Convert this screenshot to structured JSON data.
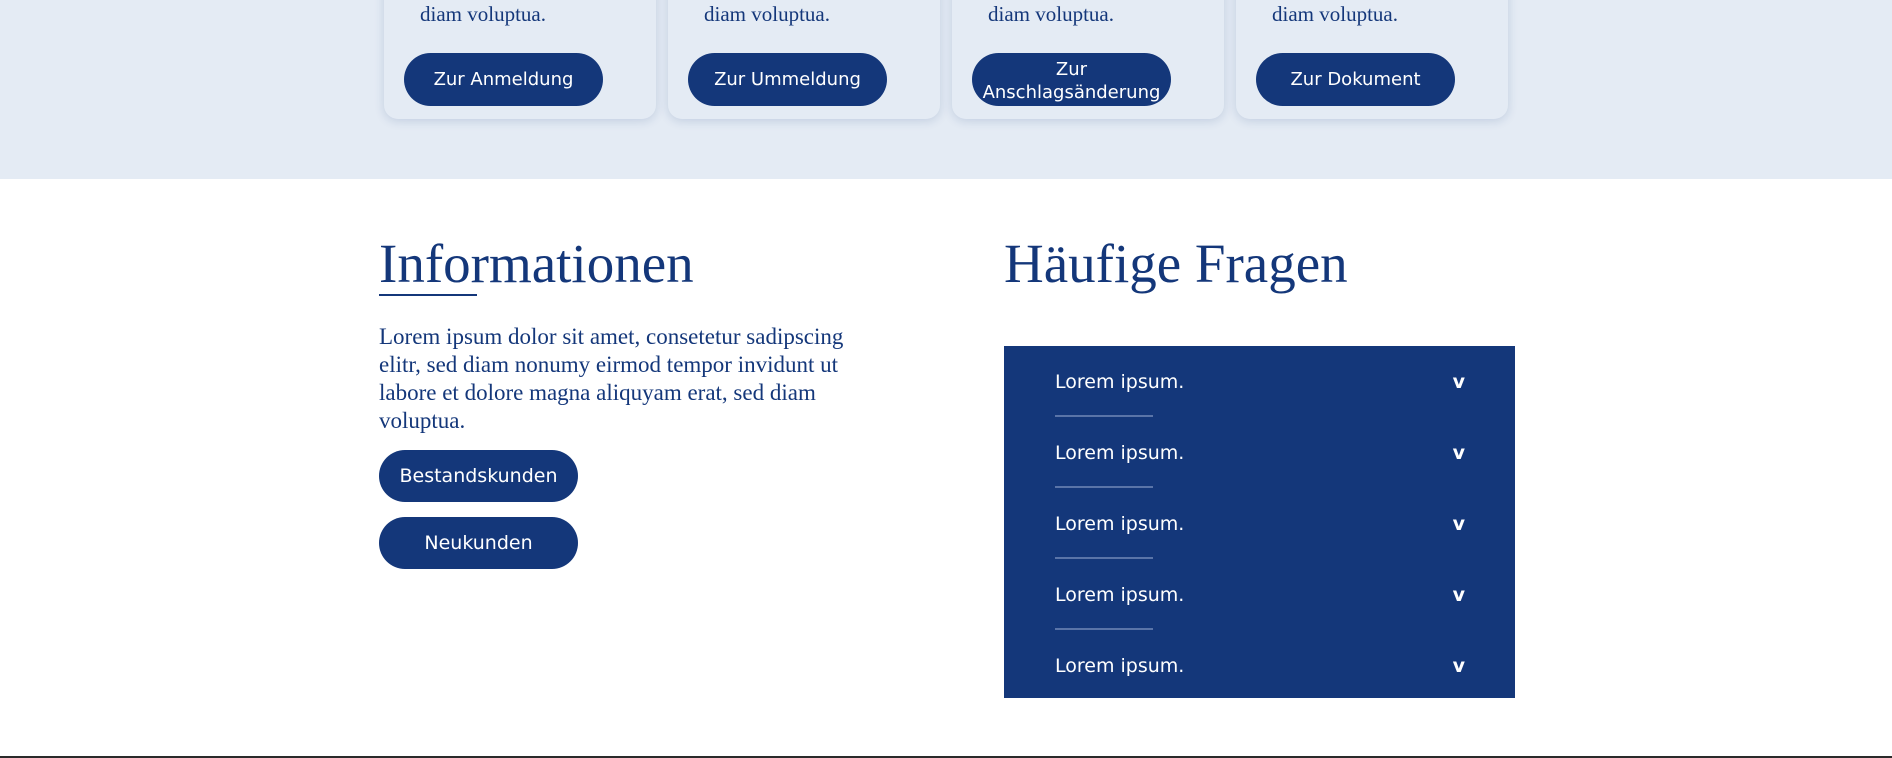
{
  "cards": [
    {
      "text": "diam voluptua.",
      "button": "Zur Anmeldung"
    },
    {
      "text": "diam voluptua.",
      "button": "Zur Ummeldung"
    },
    {
      "text": "diam voluptua.",
      "button_line1": "Zur",
      "button_line2": "Anschlagsänderung"
    },
    {
      "text": "diam voluptua.",
      "button": "Zur Dokument"
    }
  ],
  "info": {
    "title": "Informationen",
    "text": "Lorem ipsum dolor sit amet, consetetur sadipscing elitr, sed diam nonumy eirmod tempor invidunt ut labore et dolore magna aliquyam erat, sed diam voluptua.",
    "buttons": [
      "Bestandskunden",
      "Neukunden"
    ]
  },
  "faq": {
    "title": "Häufige Fragen",
    "chevron": "v",
    "items": [
      "Lorem ipsum.",
      "Lorem ipsum.",
      "Lorem ipsum.",
      "Lorem ipsum.",
      "Lorem ipsum."
    ]
  },
  "colors": {
    "brand": "#14377a",
    "band": "#e4ebf4",
    "white": "#ffffff"
  }
}
